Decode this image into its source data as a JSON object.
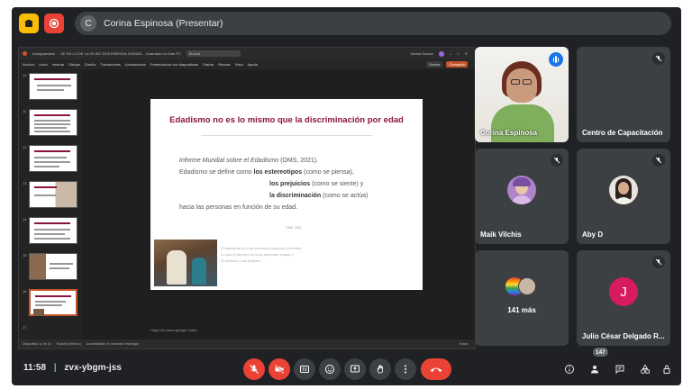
{
  "topbar": {
    "presenter_label": "Corina Espinosa (Presentar)",
    "presenter_initial": "C"
  },
  "presentation": {
    "window_title_left": "Autoguardado",
    "window_title_center": "CE EN LO DE LA VEJEZ 2025 ENERGIA DIGNAS... Guardado en Este PC",
    "search_placeholder": "Buscar",
    "user": "Karina Suarez",
    "menu": [
      "Archivo",
      "Inicio",
      "Insertar",
      "Dibujar",
      "Diseño",
      "Transiciones",
      "Animaciones",
      "Presentación con diapositivas",
      "Grabar",
      "Revisar",
      "Vista",
      "Ayuda"
    ],
    "menu_buttons": [
      "Grabar",
      "Compartir"
    ],
    "thumb_numbers": [
      "10",
      "11",
      "12",
      "13",
      "14",
      "15",
      "16",
      "17"
    ],
    "slide": {
      "title": "Edadismo no es lo mismo que la discriminación por edad",
      "line1_italic": "Informe Mundial sobre el Edadismo",
      "line1_rest": " (OMS, 2021).",
      "line2_pre": "Edadismo se define como ",
      "line2_bold": "los estereotipos",
      "line2_post": " (como se piensa),",
      "line3_bold": "los prejuicios",
      "line3_post": " (como se siente) y",
      "line4_bold": "la discriminación",
      "line4_post": " (como se actúa)",
      "line5": "hacia las personas en función de su edad.",
      "source": "OMS, 2021",
      "notes": [
        "El edadismo es a las personas mayores (Jóvenes)",
        "Lo que el racismo es a las personas negras y",
        "El sexismo a las mujeres"
      ]
    },
    "notes_placeholder": "Haga clic para agregar notas",
    "status_left": "Diapositiva 14 de 24",
    "status_lang": "Español (México)",
    "status_accessibility": "Accesibilidad: es necesario investigar",
    "status_right": "Notas"
  },
  "participants": [
    {
      "name": "Corina Espinosa",
      "type": "video",
      "speaking": true
    },
    {
      "name": "Centro de Capacitación",
      "type": "empty",
      "muted": true
    },
    {
      "name": "Maik Vilchis",
      "type": "avatar",
      "muted": true,
      "avatar_color": "#b084c9"
    },
    {
      "name": "Aby D",
      "type": "avatar",
      "muted": true,
      "avatar_color": "#6d5a52"
    },
    {
      "name": "141 más",
      "type": "group"
    },
    {
      "name": "Julio César Delgado R...",
      "type": "initial",
      "initial": "J",
      "muted": true,
      "avatar_color": "#d81b60"
    }
  ],
  "bottombar": {
    "time": "11:58",
    "separator": "|",
    "meeting_code": "zvx-ybgm-jss",
    "participant_count": "147"
  },
  "colors": {
    "background": "#202124",
    "tile": "#3c4043",
    "red": "#ea4335",
    "blue": "#1a73e8",
    "slide_title": "#8a1538",
    "ppt_accent": "#c4552a"
  }
}
